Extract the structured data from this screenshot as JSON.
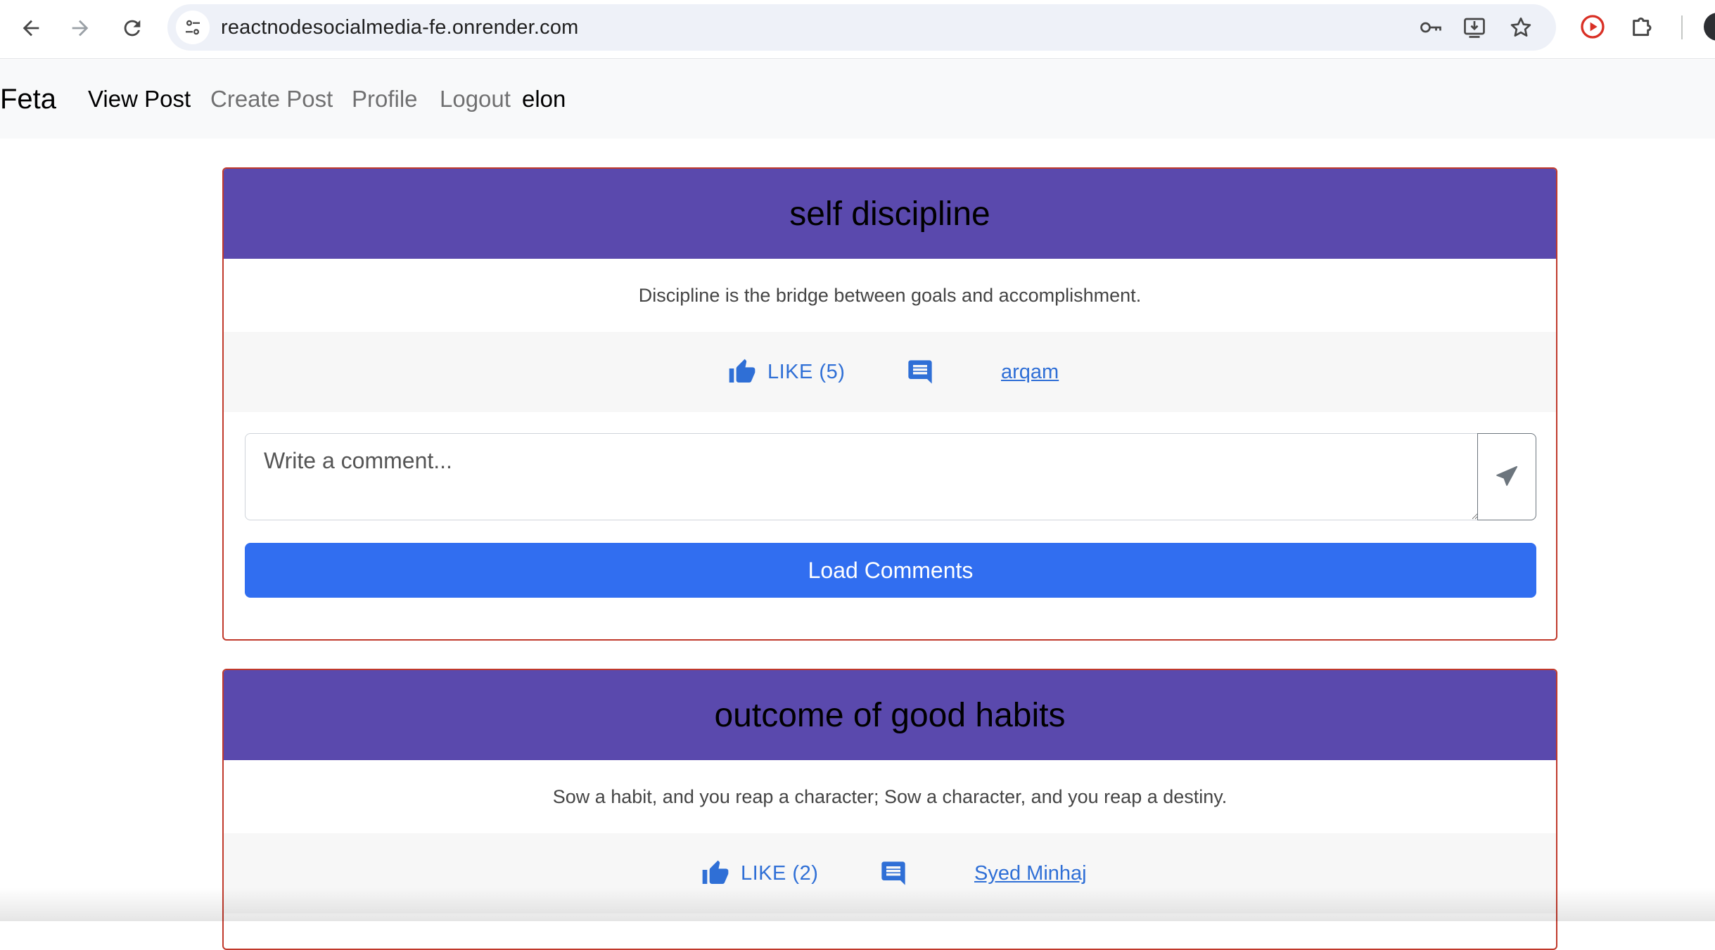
{
  "browser": {
    "url": "reactnodesocialmedia-fe.onrender.com"
  },
  "navbar": {
    "brand": "Feta",
    "links": [
      {
        "label": "View Post",
        "active": true
      },
      {
        "label": "Create Post",
        "active": false
      },
      {
        "label": "Profile",
        "active": false
      },
      {
        "label": "Logout",
        "active": false
      }
    ],
    "username": "elon"
  },
  "posts": [
    {
      "title": "self discipline",
      "body": "Discipline is the bridge between goals and accomplishment.",
      "like_label": "LIKE (5)",
      "like_count": 5,
      "author": "arqam",
      "comment_placeholder": "Write a comment...",
      "load_comments_label": "Load Comments"
    },
    {
      "title": "outcome of good habits",
      "body": "Sow a habit, and you reap a character; Sow a character, and you reap a destiny.",
      "like_label": "LIKE (2)",
      "like_count": 2,
      "author": "Syed Minhaj"
    }
  ],
  "icons": {
    "back": "arrow-left-icon",
    "forward": "arrow-right-icon",
    "reload": "reload-icon",
    "site_info": "tune-icon",
    "password": "key-icon",
    "install": "install-icon",
    "bookmark": "star-icon",
    "extension_1": "play-circle-icon",
    "extensions": "puzzle-icon",
    "like": "thumbs-up-icon",
    "comment": "comment-icon",
    "send": "send-icon"
  },
  "colors": {
    "card_header": "#5a49ad",
    "card_border": "#c0392b",
    "link_blue": "#2f6fd6",
    "button_blue": "#316ef0",
    "navbar_bg": "#f8f9fa"
  }
}
